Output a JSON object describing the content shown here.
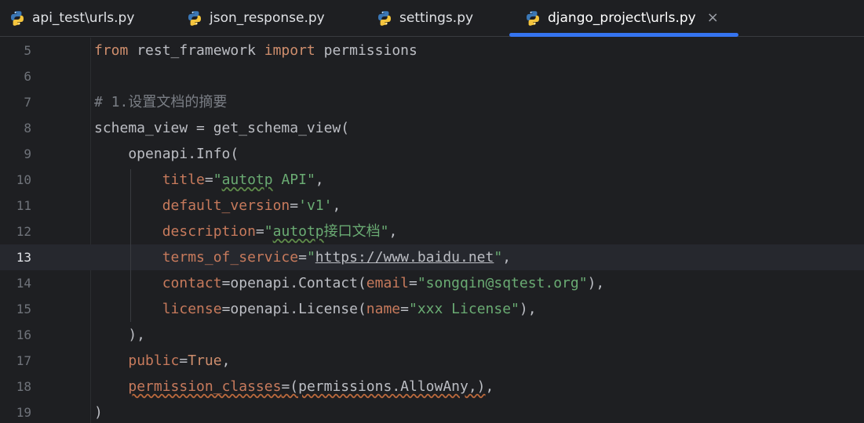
{
  "tabs": [
    {
      "label": "api_test\\urls.py",
      "icon": "python-icon",
      "active": false
    },
    {
      "label": "json_response.py",
      "icon": "python-icon",
      "active": false
    },
    {
      "label": "settings.py",
      "icon": "python-icon",
      "active": false
    },
    {
      "label": "django_project\\urls.py",
      "icon": "python-icon",
      "active": true,
      "close": "×"
    }
  ],
  "editor": {
    "current_line": 13,
    "lines": [
      {
        "number": "5",
        "tokens": [
          {
            "t": "from",
            "c": "kw"
          },
          {
            "t": " rest_framework ",
            "c": ""
          },
          {
            "t": "import",
            "c": "kw"
          },
          {
            "t": " permissions",
            "c": ""
          }
        ]
      },
      {
        "number": "6",
        "tokens": []
      },
      {
        "number": "7",
        "tokens": [
          {
            "t": "# 1.设置文档的摘要",
            "c": "cm"
          }
        ]
      },
      {
        "number": "8",
        "tokens": [
          {
            "t": "schema_view = get_schema_view(",
            "c": ""
          }
        ]
      },
      {
        "number": "9",
        "tokens": [
          {
            "t": "    openapi.Info(",
            "c": ""
          }
        ]
      },
      {
        "number": "10",
        "tokens": [
          {
            "t": "        ",
            "c": ""
          },
          {
            "t": "title",
            "c": "param"
          },
          {
            "t": "=",
            "c": ""
          },
          {
            "t": "\"",
            "c": "str"
          },
          {
            "t": "autotp",
            "c": "str wavy-green"
          },
          {
            "t": " API\"",
            "c": "str"
          },
          {
            "t": ",",
            "c": ""
          }
        ]
      },
      {
        "number": "11",
        "tokens": [
          {
            "t": "        ",
            "c": ""
          },
          {
            "t": "default_version",
            "c": "param"
          },
          {
            "t": "=",
            "c": ""
          },
          {
            "t": "'v1'",
            "c": "str"
          },
          {
            "t": ",",
            "c": ""
          }
        ]
      },
      {
        "number": "12",
        "tokens": [
          {
            "t": "        ",
            "c": ""
          },
          {
            "t": "description",
            "c": "param"
          },
          {
            "t": "=",
            "c": ""
          },
          {
            "t": "\"",
            "c": "str"
          },
          {
            "t": "autotp",
            "c": "str wavy-green"
          },
          {
            "t": "接口文档\"",
            "c": "str"
          },
          {
            "t": ",",
            "c": ""
          }
        ]
      },
      {
        "number": "13",
        "tokens": [
          {
            "t": "        ",
            "c": ""
          },
          {
            "t": "terms_of_service",
            "c": "param"
          },
          {
            "t": "=",
            "c": ""
          },
          {
            "t": "\"",
            "c": "str"
          },
          {
            "t": "https://www.baidu.net",
            "c": "str url"
          },
          {
            "t": "\"",
            "c": "str"
          },
          {
            "t": ",",
            "c": ""
          }
        ]
      },
      {
        "number": "14",
        "tokens": [
          {
            "t": "        ",
            "c": ""
          },
          {
            "t": "contact",
            "c": "param"
          },
          {
            "t": "=openapi.Contact(",
            "c": ""
          },
          {
            "t": "email",
            "c": "param"
          },
          {
            "t": "=",
            "c": ""
          },
          {
            "t": "\"songqin@sqtest.org\"",
            "c": "str"
          },
          {
            "t": "),",
            "c": ""
          }
        ]
      },
      {
        "number": "15",
        "tokens": [
          {
            "t": "        ",
            "c": ""
          },
          {
            "t": "license",
            "c": "param"
          },
          {
            "t": "=openapi.License(",
            "c": ""
          },
          {
            "t": "name",
            "c": "param"
          },
          {
            "t": "=",
            "c": ""
          },
          {
            "t": "\"xxx License\"",
            "c": "str"
          },
          {
            "t": "),",
            "c": ""
          }
        ]
      },
      {
        "number": "16",
        "tokens": [
          {
            "t": "    ),",
            "c": ""
          }
        ]
      },
      {
        "number": "17",
        "tokens": [
          {
            "t": "    ",
            "c": ""
          },
          {
            "t": "public",
            "c": "param"
          },
          {
            "t": "=",
            "c": ""
          },
          {
            "t": "True",
            "c": "kw"
          },
          {
            "t": ",",
            "c": ""
          }
        ]
      },
      {
        "number": "18",
        "tokens": [
          {
            "t": "    ",
            "c": ""
          },
          {
            "t": "permission_classes",
            "c": "param wavy-red"
          },
          {
            "t": "=(permissions.AllowAny,)",
            "c": "wavy-red"
          },
          {
            "t": ",",
            "c": ""
          }
        ]
      },
      {
        "number": "19",
        "tokens": [
          {
            "t": ")",
            "c": ""
          }
        ]
      }
    ]
  },
  "colors": {
    "background": "#1e1f22",
    "accent": "#3574f0",
    "keyword": "#cf8e6d",
    "string": "#6aab73",
    "comment": "#7a7e85",
    "param": "#c77a5c"
  }
}
